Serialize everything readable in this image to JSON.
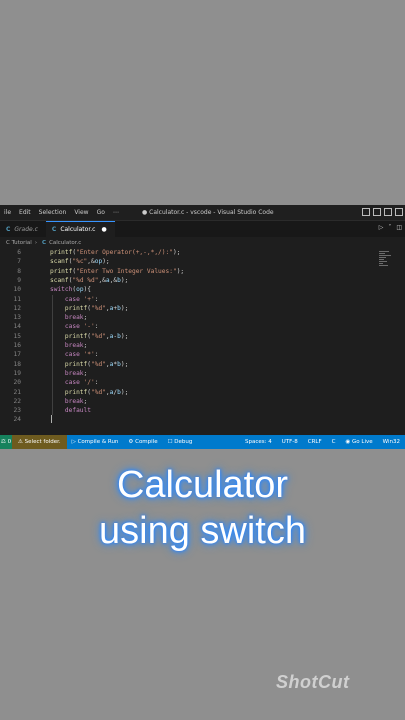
{
  "window": {
    "menu": [
      "ile",
      "Edit",
      "Selection",
      "View",
      "Go",
      "⋯"
    ],
    "title": "● Calculator.c - vscode - Visual Studio Code"
  },
  "tabs": [
    {
      "label": "Grade.c",
      "icon": "C",
      "active": false
    },
    {
      "label": "Calculator.c",
      "icon": "C",
      "active": true,
      "modified": "●"
    }
  ],
  "breadcrumb": {
    "folder": "C Tutorial",
    "sep": "›",
    "icon": "C",
    "file": "Calculator.c"
  },
  "code_lines": [
    {
      "n": "6",
      "text": "printf(\"Enter Operator(+,-,*,/):\");"
    },
    {
      "n": "7",
      "text": "scanf(\"%c\",&op);"
    },
    {
      "n": "8",
      "text": "printf(\"Enter Two Integer Values:\");"
    },
    {
      "n": "9",
      "text": "scanf(\"%d %d\",&a,&b);"
    },
    {
      "n": "10",
      "text": "switch(op){"
    },
    {
      "n": "11",
      "text": "    case '+':"
    },
    {
      "n": "12",
      "text": "    printf(\"%d\",a+b);"
    },
    {
      "n": "13",
      "text": "    break;"
    },
    {
      "n": "14",
      "text": "    case '-':"
    },
    {
      "n": "15",
      "text": "    printf(\"%d\",a-b);"
    },
    {
      "n": "16",
      "text": "    break;"
    },
    {
      "n": "17",
      "text": "    case '*':"
    },
    {
      "n": "18",
      "text": "    printf(\"%d\",a*b);"
    },
    {
      "n": "19",
      "text": "    break;"
    },
    {
      "n": "20",
      "text": "    case '/':"
    },
    {
      "n": "21",
      "text": "    printf(\"%d\",a/b);"
    },
    {
      "n": "22",
      "text": "    break;"
    },
    {
      "n": "23",
      "text": "    default"
    },
    {
      "n": "24",
      "text": ""
    }
  ],
  "status": {
    "remote": "⚖ 0",
    "select_folder": "⚠ Select folder.",
    "compile_run": "▷ Compile & Run",
    "compile": "⚙ Compile",
    "debug": "☐ Debug",
    "spaces": "Spaces: 4",
    "encoding": "UTF-8",
    "eol": "CRLF",
    "language": "C",
    "go_live": "◉ Go Live",
    "platform": "Win32"
  },
  "caption": {
    "line1": "Calculator",
    "line2": "using switch"
  },
  "watermark": "ShotCut",
  "colors": {
    "statusbar": "#007acc",
    "editor_bg": "#1e1e1e",
    "caption_glow": "#2f8fff"
  }
}
